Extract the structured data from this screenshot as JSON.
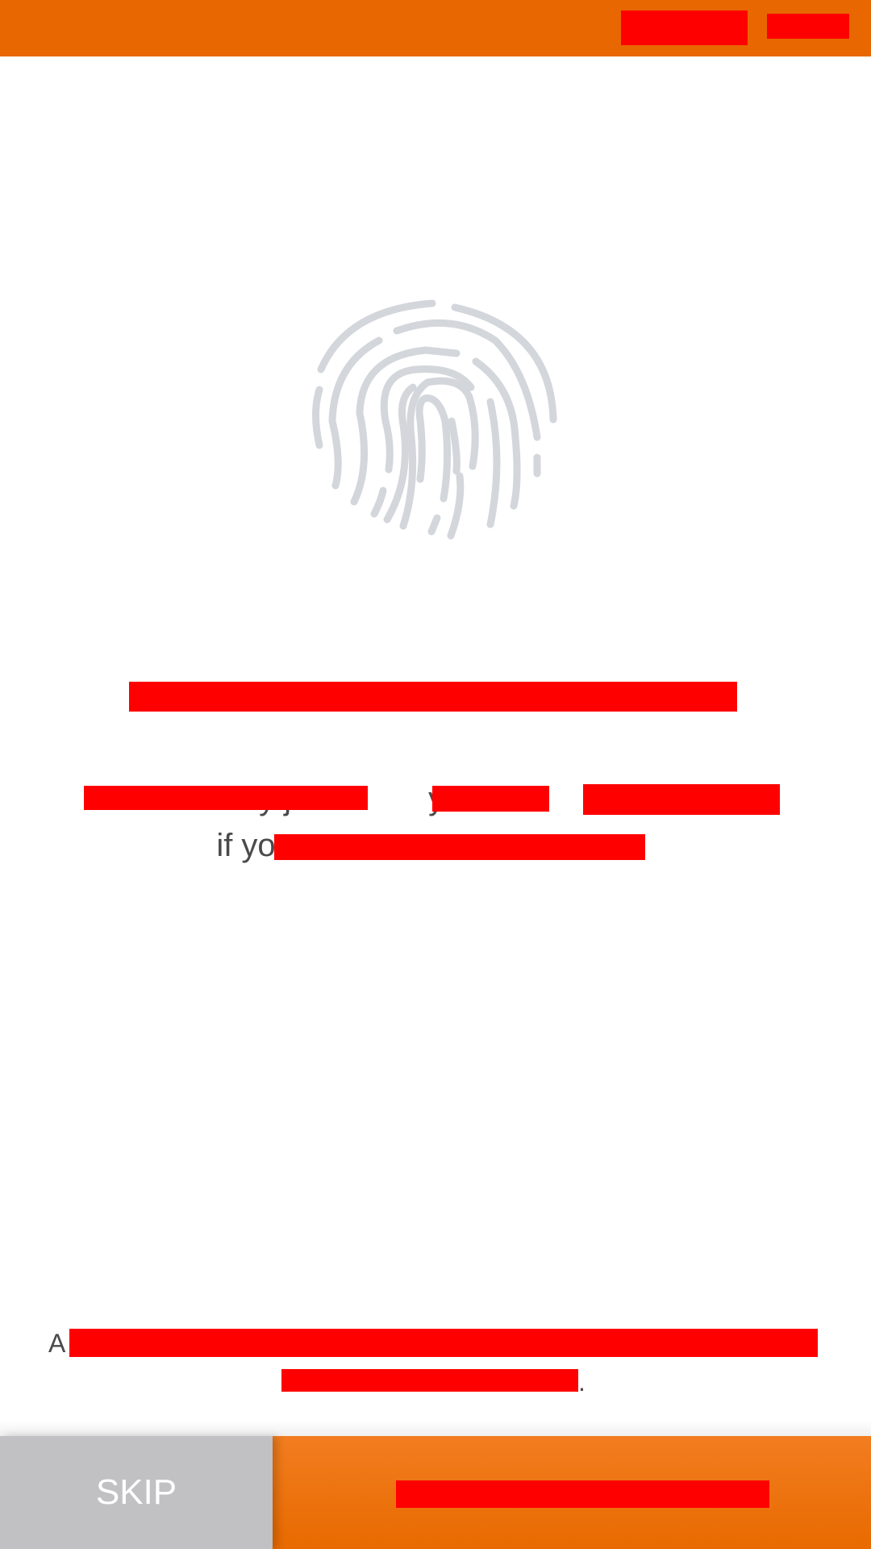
{
  "status_bar": {
    "background": "#e86700",
    "redacted_items": [
      "status-right-redacted-1",
      "status-right-redacted-2"
    ]
  },
  "hero": {
    "icon": "fingerprint-icon",
    "icon_color": "#d3d6db"
  },
  "description": {
    "line1_visible": {
      "part1": "by j",
      "part2": "y"
    },
    "line2_visible": {
      "part1": "if yo"
    }
  },
  "footnote": {
    "visible_start": "A",
    "visible_end": "."
  },
  "buttons": {
    "skip_label": "SKIP",
    "skip_background": "#c1c0c3",
    "primary_background": "#f27d20"
  },
  "colors": {
    "accent": "#e86700",
    "redaction": "#ff0000",
    "text": "#4a4a4a"
  }
}
